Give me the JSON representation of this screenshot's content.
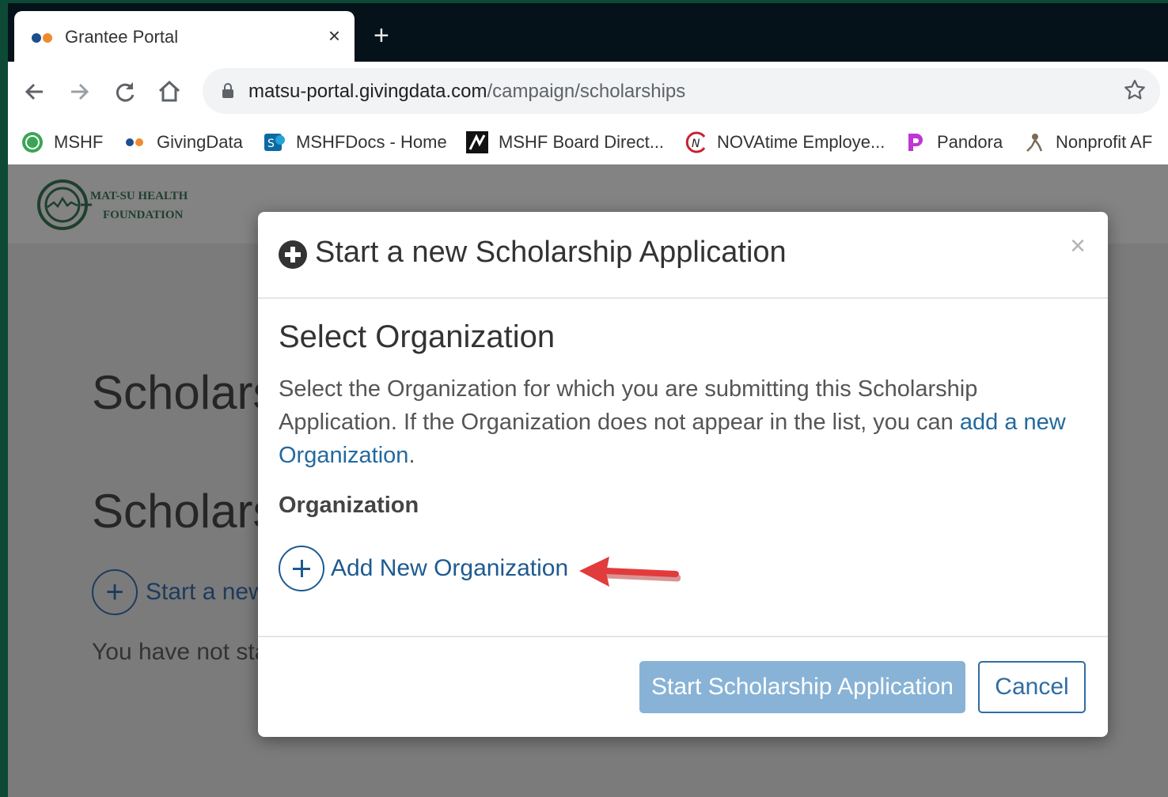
{
  "browser": {
    "tab": {
      "title": "Grantee Portal",
      "close_glyph": "×"
    },
    "new_tab_glyph": "+",
    "address": {
      "host": "matsu-portal.givingdata.com",
      "path": "/campaign/scholarships"
    },
    "bookmarks": [
      {
        "label": "MSHF",
        "icon": "mshf-icon"
      },
      {
        "label": "GivingData",
        "icon": "givingdata-icon"
      },
      {
        "label": "MSHFDocs - Home",
        "icon": "sharepoint-icon"
      },
      {
        "label": "MSHF Board Direct...",
        "icon": "boarddirect-icon"
      },
      {
        "label": "NOVAtime Employe...",
        "icon": "novatime-icon"
      },
      {
        "label": "Pandora",
        "icon": "pandora-icon"
      },
      {
        "label": "Nonprofit AF",
        "icon": "nonprofit-icon"
      }
    ]
  },
  "page": {
    "logo": {
      "line1": "MAT-SU HEALTH",
      "line2": "FOUNDATION"
    },
    "heading1": "Scholars",
    "heading2": "Scholars",
    "start_link": "Start a new",
    "start_glyph": "+",
    "empty_note": "You have not sta"
  },
  "modal": {
    "title": "Start a new Scholarship Application",
    "close_glyph": "×",
    "section_title": "Select Organization",
    "description": "Select the Organization for which you are submitting this Scholarship Application. If the Organization does not appear in the list, you can ",
    "description_link": "add a new Organization",
    "description_end": ".",
    "field_label": "Organization",
    "add_org_label": "Add New Organization",
    "start_button": "Start Scholarship Application",
    "cancel_button": "Cancel"
  },
  "colors": {
    "frame": "#0c4a35",
    "link": "#23699e",
    "primary_disabled": "#88b3d6",
    "arrow": "#e23b3b"
  }
}
